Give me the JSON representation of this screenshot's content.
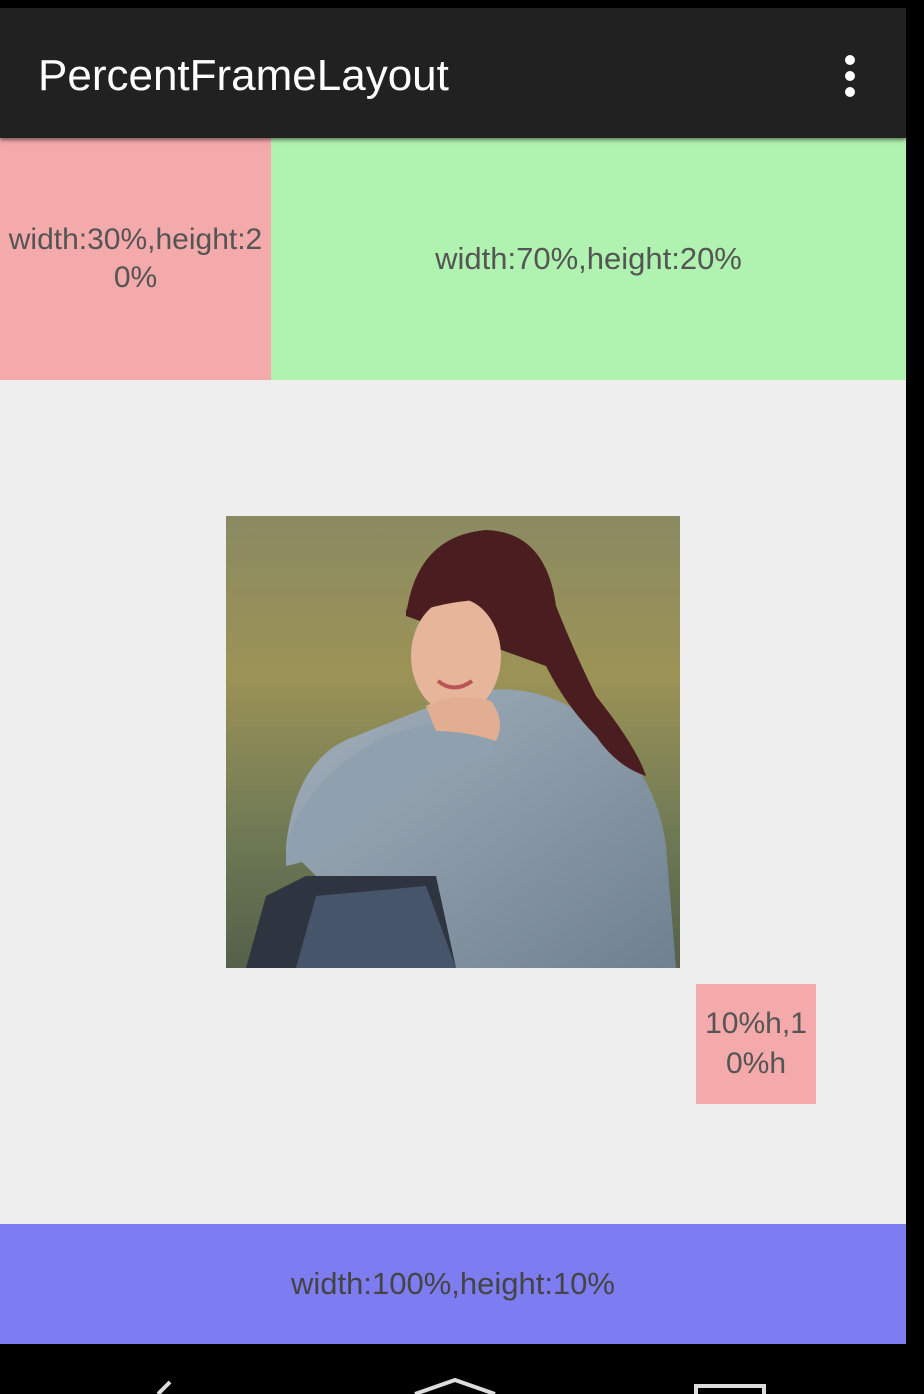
{
  "appbar": {
    "title": "PercentFrameLayout",
    "menu_icon": "more-vert-icon"
  },
  "boxes": {
    "top_left": "width:30%,height:20%",
    "top_right": "width:70%,height:20%",
    "small": "10%h,10%h",
    "bottom": "width:100%,height:10%"
  },
  "image": {
    "subject": "photo"
  },
  "navbar": {
    "icons": [
      "back-icon",
      "home-icon",
      "recents-icon"
    ]
  },
  "colors": {
    "appbar": "#212121",
    "content_bg": "#eeeeee",
    "pink": "#f4a9ab",
    "green": "#b0f2b0",
    "blue": "#7d7cf0"
  }
}
